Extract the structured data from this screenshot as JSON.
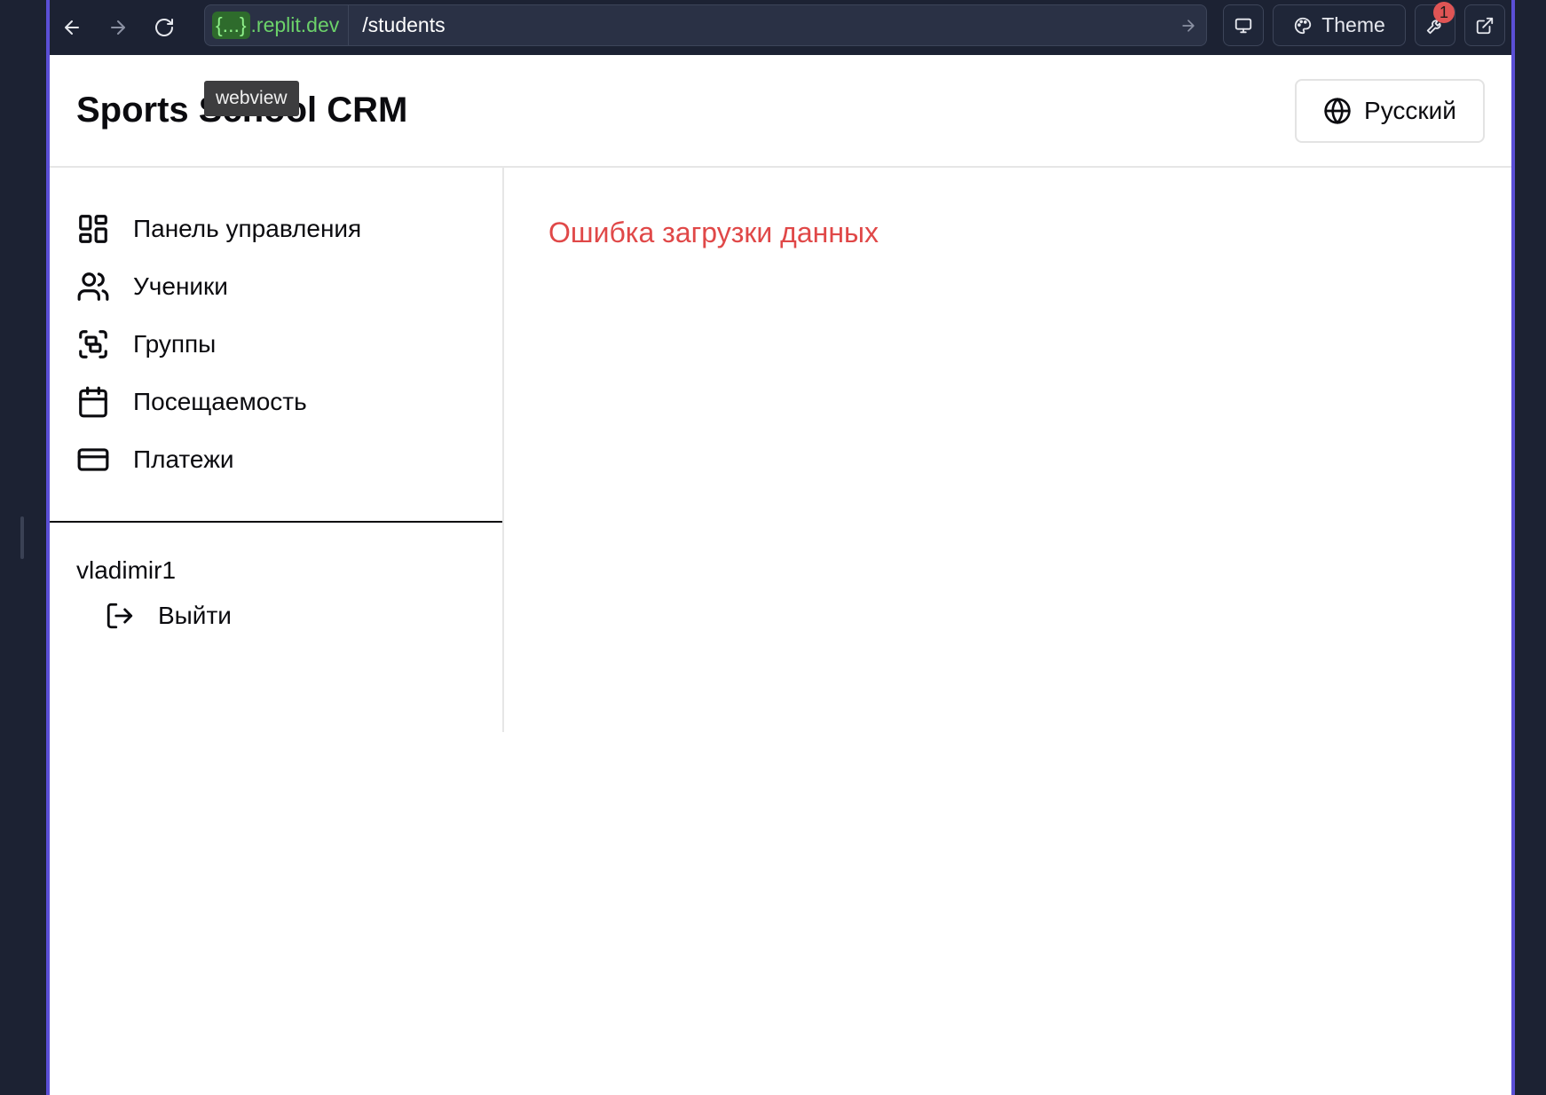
{
  "browser": {
    "url_host_braces": "{...}",
    "url_host": ".replit.dev",
    "url_path": "/students",
    "theme_label": "Theme",
    "notification_count": "1",
    "tooltip": "webview"
  },
  "app": {
    "title": "Sports School CRM",
    "language": "Русский",
    "nav": [
      {
        "label": "Панель управления",
        "icon": "dashboard-icon"
      },
      {
        "label": "Ученики",
        "icon": "users-icon"
      },
      {
        "label": "Группы",
        "icon": "groups-icon"
      },
      {
        "label": "Посещаемость",
        "icon": "calendar-icon"
      },
      {
        "label": "Платежи",
        "icon": "credit-card-icon"
      }
    ],
    "username": "vladimir1",
    "logout_label": "Выйти",
    "error_message": "Ошибка загрузки данных"
  },
  "colors": {
    "accent_frame": "#5b4fd6",
    "error": "#e04848",
    "host_green": "#6cd26a"
  }
}
